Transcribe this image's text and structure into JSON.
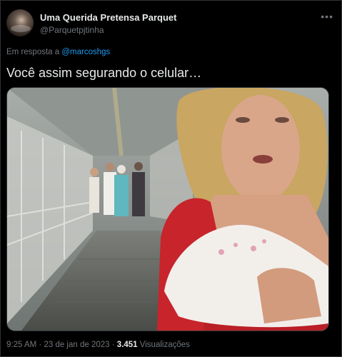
{
  "author": {
    "display_name": "Uma Querida Pretensa Parquet",
    "handle": "@Parquetpjtinha",
    "avatar_icon": "avatar"
  },
  "more_icon": "more-icon",
  "reply_context": {
    "prefix": "Em resposta a",
    "mention": "@marcoshgs"
  },
  "tweet": {
    "text": "Você assim segurando o celular…"
  },
  "media": {
    "description_icon": "photo"
  },
  "metadata": {
    "time": "9:25 AM",
    "separator": "·",
    "date": "23 de jan de 2023",
    "views_count": "3.451",
    "views_label": "Visualizações"
  },
  "colors": {
    "background": "#000000",
    "text": "#e7e9ea",
    "muted": "#71767b",
    "accent": "#1d9bf0",
    "border": "#2f3336"
  }
}
